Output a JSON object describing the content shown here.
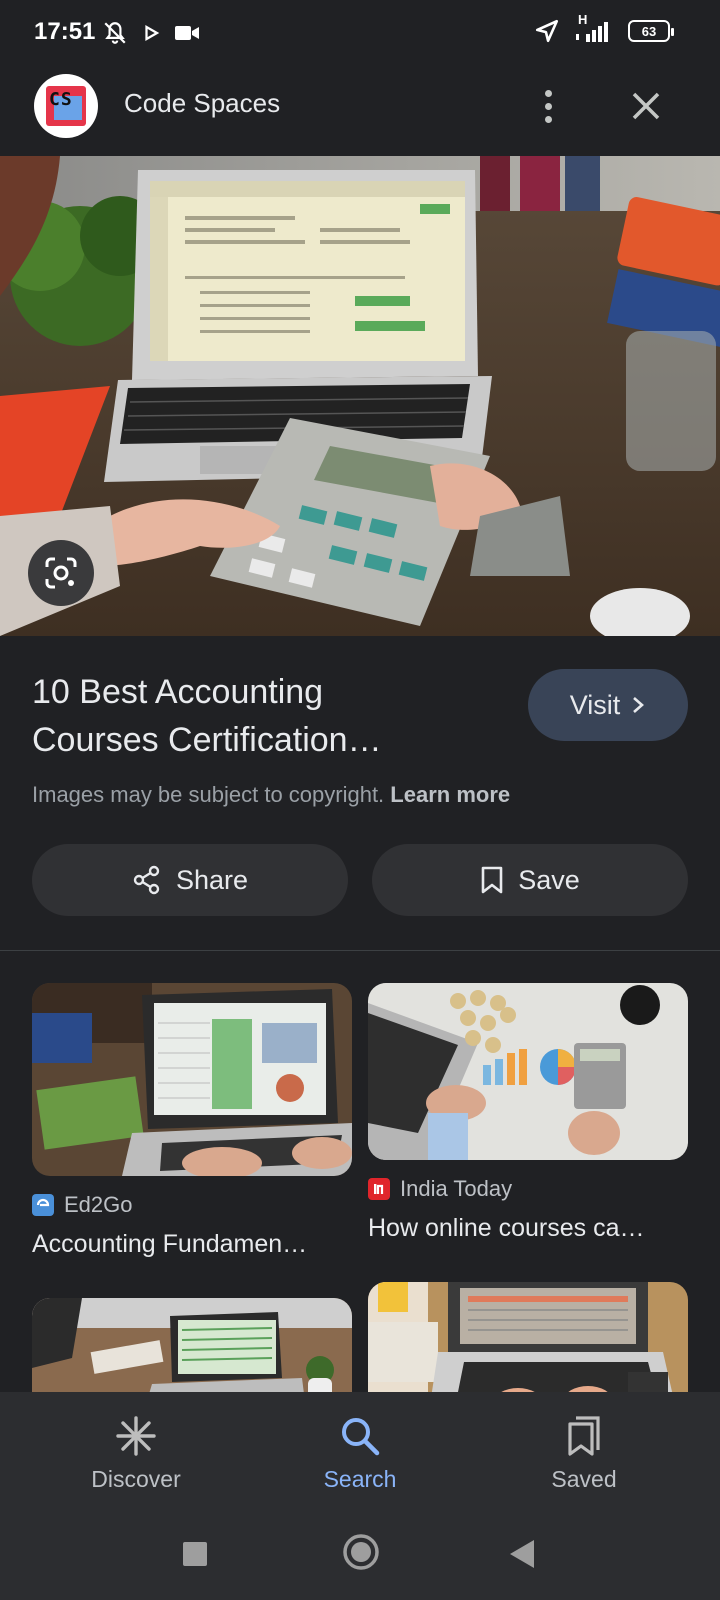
{
  "status_bar": {
    "time": "17:51",
    "network_type": "H",
    "battery": "63"
  },
  "header": {
    "site_name": "Code Spaces",
    "logo_text": "CS",
    "more_icon": "more-vert-icon",
    "close_icon": "close-icon"
  },
  "hero": {
    "lens_icon": "google-lens-icon"
  },
  "result": {
    "title_line1": "10 Best Accounting",
    "title_line2": "Courses Certification…",
    "visit_label": "Visit",
    "copyright_text": "Images may be subject to copyright.",
    "learn_more": "Learn more",
    "share_label": "Share",
    "save_label": "Save"
  },
  "related": [
    {
      "source": "Ed2Go",
      "title": "Accounting Fundamen…",
      "favicon_color": "#4a90d9"
    },
    {
      "source": "India Today",
      "title": "How online courses ca…",
      "favicon_color": "#e0252b"
    }
  ],
  "bottom_nav": {
    "items": [
      {
        "label": "Discover",
        "icon": "asterisk-icon"
      },
      {
        "label": "Search",
        "icon": "search-icon",
        "active": true
      },
      {
        "label": "Saved",
        "icon": "saved-collection-icon"
      }
    ]
  },
  "colors": {
    "background": "#202124",
    "accent": "#8ab4f8",
    "visit_button": "#394457",
    "pill_button": "#303134"
  }
}
